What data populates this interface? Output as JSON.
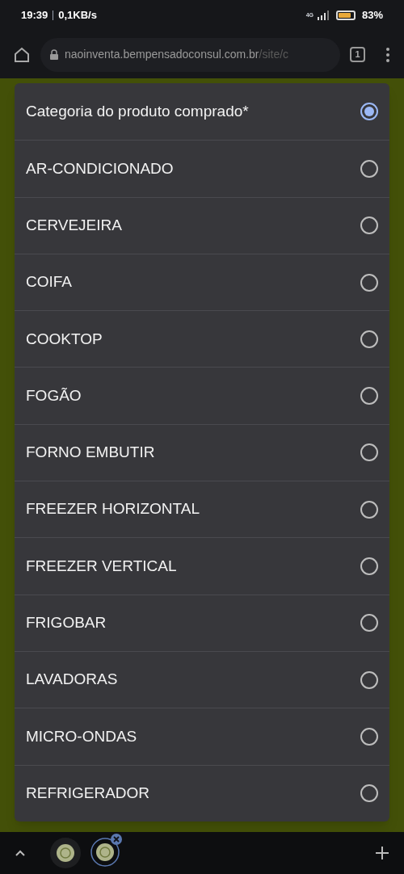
{
  "status_bar": {
    "time": "19:39",
    "speed": "0,1KB/s",
    "network": "4G",
    "battery": {
      "text": "83%"
    }
  },
  "browser": {
    "url_host": "naoinventa.bempensadoconsul.com.br",
    "url_path": "/site/c",
    "tab_count": "1"
  },
  "dialog": {
    "options": [
      {
        "label": "Categoria do produto comprado*",
        "selected": true
      },
      {
        "label": "AR-CONDICIONADO",
        "selected": false
      },
      {
        "label": "CERVEJEIRA",
        "selected": false
      },
      {
        "label": "COIFA",
        "selected": false
      },
      {
        "label": "COOKTOP",
        "selected": false
      },
      {
        "label": "FOGÃO",
        "selected": false
      },
      {
        "label": "FORNO EMBUTIR",
        "selected": false
      },
      {
        "label": "FREEZER HORIZONTAL",
        "selected": false
      },
      {
        "label": "FREEZER VERTICAL",
        "selected": false
      },
      {
        "label": "FRIGOBAR",
        "selected": false
      },
      {
        "label": "LAVADORAS",
        "selected": false
      },
      {
        "label": "MICRO-ONDAS",
        "selected": false
      },
      {
        "label": "REFRIGERADOR",
        "selected": false
      }
    ]
  }
}
